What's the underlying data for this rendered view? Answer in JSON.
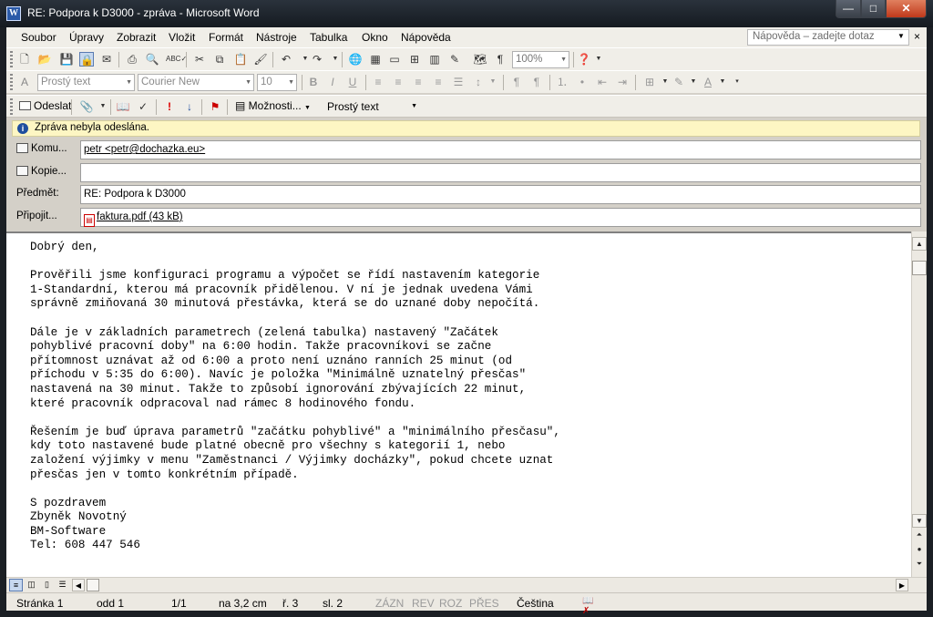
{
  "window": {
    "title": "RE: Podpora k D3000 - zpráva - Microsoft Word",
    "app_icon": "W",
    "controls": {
      "minimize": "—",
      "maximize": "□",
      "close": "✕"
    }
  },
  "menubar": {
    "items": [
      "Soubor",
      "Úpravy",
      "Zobrazit",
      "Vložit",
      "Formát",
      "Nástroje",
      "Tabulka",
      "Okno",
      "Nápověda"
    ],
    "help_placeholder": "Nápověda – zadejte dotaz",
    "close_doc": "×"
  },
  "toolbar_standard": {
    "zoom": "100%"
  },
  "toolbar_format": {
    "style": "Prostý text",
    "font": "Courier New",
    "size": "10"
  },
  "toolbar_email": {
    "send_label": "Odeslat",
    "options_label": "Možnosti...",
    "format_label": "Prostý text"
  },
  "infobar": {
    "message": "Zpráva nebyla odeslána.",
    "icon": "i"
  },
  "header": {
    "to_label": "Komu...",
    "to_value": "petr <petr@dochazka.eu>",
    "cc_label": "Kopie...",
    "cc_value": "",
    "subject_label": "Předmět:",
    "subject_value": "RE: Podpora k D3000",
    "attach_label": "Připojit...",
    "attachment": "faktura.pdf (43 kB)"
  },
  "body": {
    "text": "Dobrý den,\n\nPrověřili jsme konfiguraci programu a výpočet se řídí nastavením kategorie\n1-Standardní, kterou má pracovník přidělenou. V ní je jednak uvedena Vámi\nsprávně zmiňovaná 30 minutová přestávka, která se do uznané doby nepočítá.\n\nDále je v základních parametrech (zelená tabulka) nastavený \"Začátek\npohyblivé pracovní doby\" na 6:00 hodin. Takže pracovníkovi se začne\npřítomnost uznávat až od 6:00 a proto není uznáno ranních 25 minut (od\npříchodu v 5:35 do 6:00). Navíc je položka \"Minimálně uznatelný přesčas\"\nnastavená na 30 minut. Takže to způsobí ignorování zbývajících 22 minut,\nkteré pracovník odpracoval nad rámec 8 hodinového fondu.\n\nŘešením je buď úprava parametrů \"začátku pohyblivé\" a \"minimálního přesčasu\",\nkdy toto nastavené bude platné obecně pro všechny s kategorií 1, nebo\nzaložení výjimky v menu \"Zaměstnanci / Výjimky docházky\", pokud chcete uznat\npřesčas jen v tomto konkrétním případě.\n\nS pozdravem\nZbyněk Novotný\nBM-Software\nTel: 608 447 546"
  },
  "statusbar": {
    "page": "Stránka 1",
    "section": "odd 1",
    "pages": "1/1",
    "position": "na 3,2 cm",
    "line": "ř. 3",
    "column": "sl. 2",
    "rec": "ZÁZN",
    "trk": "REV",
    "ext": "ROZ",
    "ovr": "PŘES",
    "language": "Čeština"
  },
  "icons": {
    "toolbar_standard": [
      "new-doc-icon",
      "open-icon",
      "save-icon",
      "permission-icon",
      "email-icon",
      "print-icon",
      "print-preview-icon",
      "spelling-icon",
      "cut-icon",
      "copy-icon",
      "paste-icon",
      "format-painter-icon",
      "undo-icon",
      "redo-icon",
      "hyperlink-icon",
      "tables-borders-icon",
      "insert-table-icon",
      "insert-excel-icon",
      "columns-icon",
      "drawing-icon",
      "document-map-icon",
      "show-formatting-icon",
      "help-icon"
    ],
    "toolbar_format": [
      "bold-icon",
      "italic-icon",
      "underline-icon",
      "align-left-icon",
      "center-icon",
      "align-right-icon",
      "justify-icon",
      "distributed-icon",
      "line-spacing-icon",
      "ltr-icon",
      "rtl-icon",
      "numbering-icon",
      "bullets-icon",
      "decrease-indent-icon",
      "increase-indent-icon",
      "border-icon",
      "highlight-icon",
      "font-color-icon"
    ],
    "toolbar_email": [
      "attach-icon",
      "address-book-icon",
      "check-names-icon",
      "high-importance-icon",
      "low-importance-icon",
      "flag-icon",
      "options-icon"
    ]
  }
}
